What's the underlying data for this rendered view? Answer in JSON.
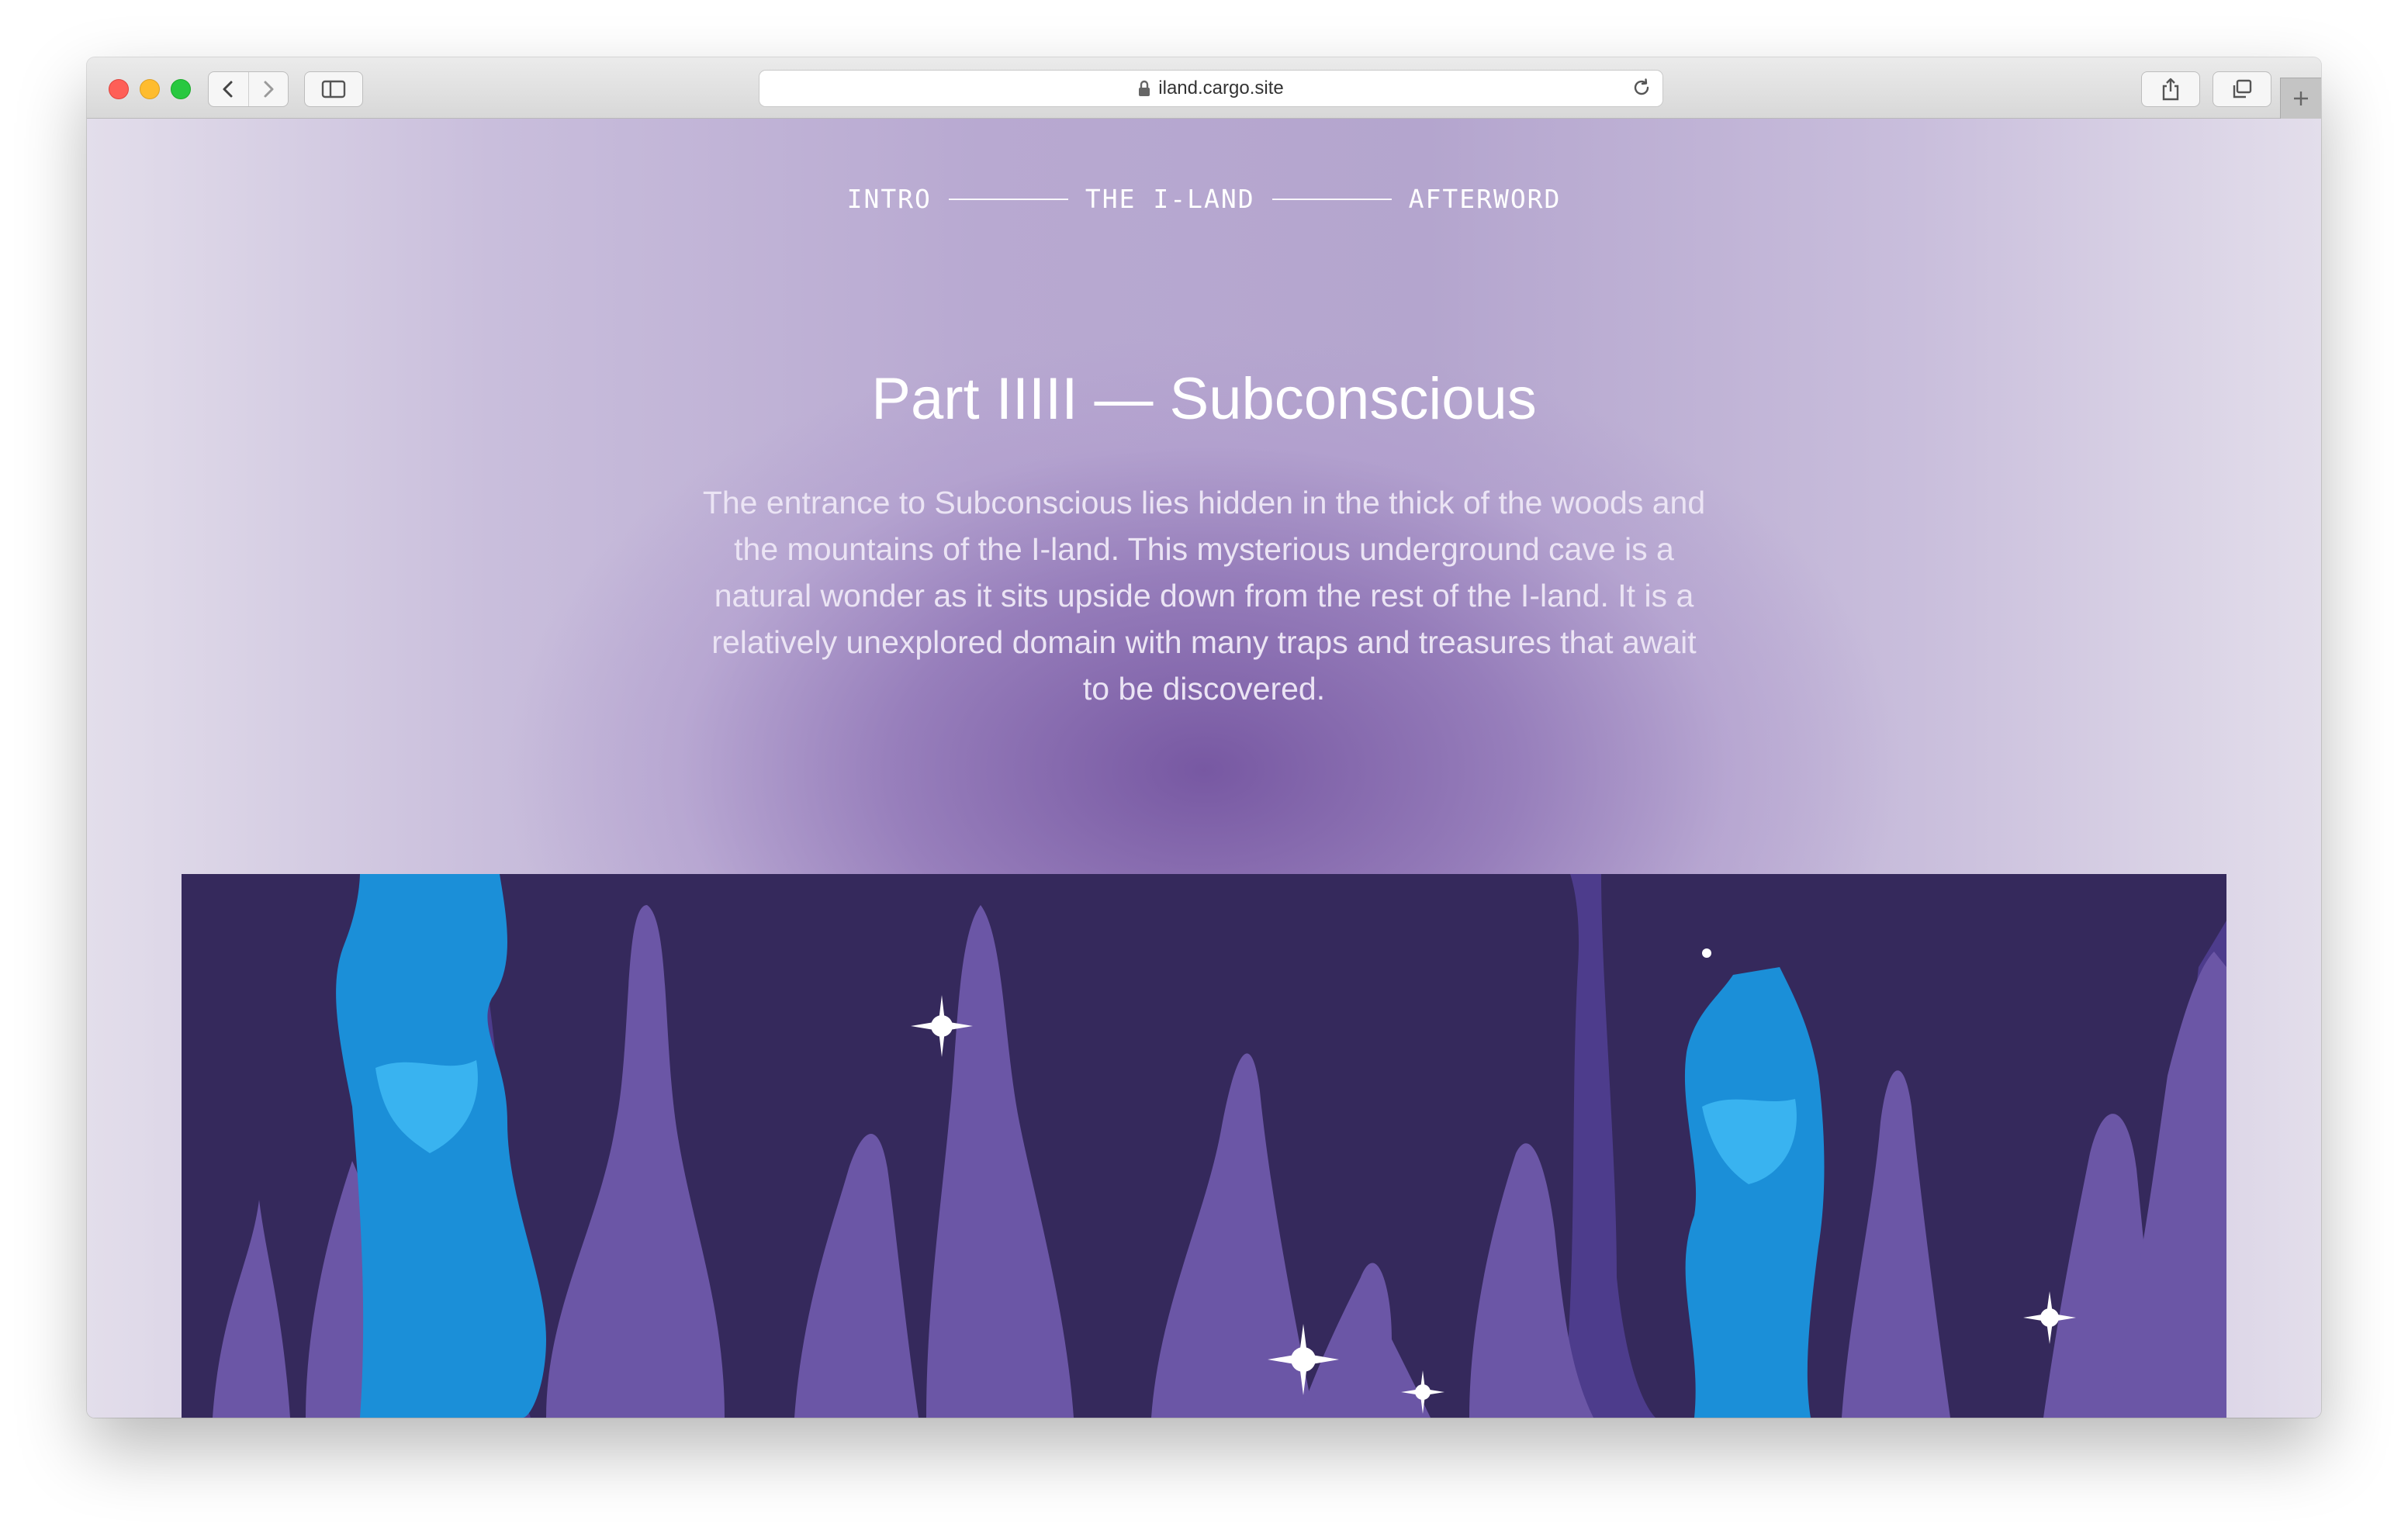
{
  "browser": {
    "url": "iland.cargo.site"
  },
  "nav": {
    "intro": "INTRO",
    "the_iland": "THE I-LAND",
    "afterword": "AFTERWORD"
  },
  "content": {
    "title": "Part IIIII — Subconscious",
    "paragraph": "The entrance to Subconscious lies hidden in the thick of the woods and the mountains of the I-land. This mysterious underground cave is a natural wonder as it sits upside down from the rest of the I-land. It is a relatively unexplored domain with many traps and treasures that await to be discovered."
  },
  "colors": {
    "cave_background": "#35295c",
    "stalagmite": "#6b56a6",
    "water": "#1b8fd8",
    "sparkle": "#ffffff"
  }
}
